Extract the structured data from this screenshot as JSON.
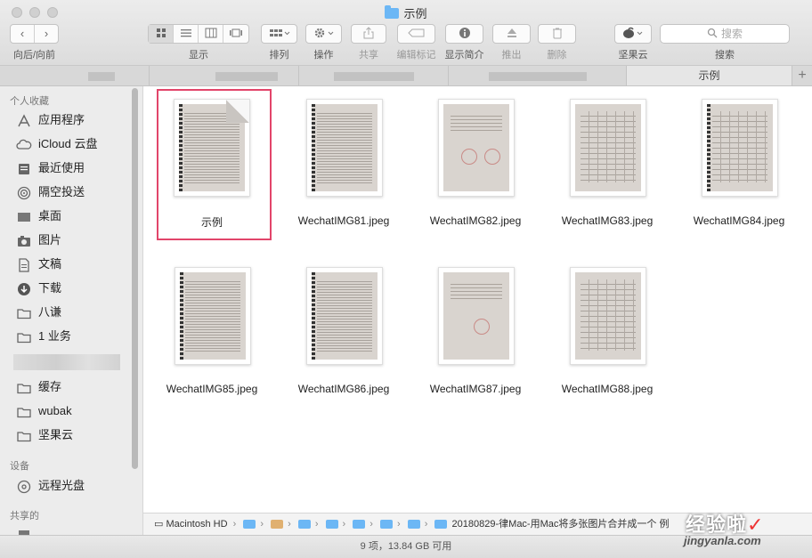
{
  "window": {
    "title": "示例"
  },
  "toolbar": {
    "nav_label": "向后/向前",
    "view_label": "显示",
    "sort_label": "排列",
    "action_label": "操作",
    "share_label": "共享",
    "tags_label": "编辑标记",
    "info_label": "显示简介",
    "eject_label": "推出",
    "delete_label": "删除",
    "nutstore_label": "坚果云",
    "search_label": "搜索",
    "search_placeholder": "搜索",
    "back_glyph": "‹",
    "forward_glyph": "›"
  },
  "tabs": {
    "active_label": "示例",
    "plus": "+"
  },
  "sidebar": {
    "favorites_header": "个人收藏",
    "favorites": [
      {
        "label": "应用程序",
        "icon": "applications-icon"
      },
      {
        "label": "iCloud 云盘",
        "icon": "icloud-icon"
      },
      {
        "label": "最近使用",
        "icon": "recents-icon"
      },
      {
        "label": "隔空投送",
        "icon": "airdrop-icon"
      },
      {
        "label": "桌面",
        "icon": "desktop-icon"
      },
      {
        "label": "图片",
        "icon": "pictures-icon"
      },
      {
        "label": "文稿",
        "icon": "documents-icon"
      },
      {
        "label": "下载",
        "icon": "downloads-icon"
      },
      {
        "label": "八谦",
        "icon": "folder-icon"
      },
      {
        "label": "1 业务",
        "icon": "folder-icon"
      },
      {
        "label": "缓存",
        "icon": "folder-icon"
      },
      {
        "label": "wubak",
        "icon": "folder-icon"
      },
      {
        "label": "坚果云",
        "icon": "folder-icon"
      }
    ],
    "devices_header": "设备",
    "devices": [
      {
        "label": "远程光盘",
        "icon": "remote-disc-icon"
      }
    ],
    "shared_header": "共享的"
  },
  "files": [
    {
      "name": "示例",
      "kind": "pdf",
      "selected": true
    },
    {
      "name": "WechatIMG81.jpeg",
      "kind": "text"
    },
    {
      "name": "WechatIMG82.jpeg",
      "kind": "letter"
    },
    {
      "name": "WechatIMG83.jpeg",
      "kind": "table"
    },
    {
      "name": "WechatIMG84.jpeg",
      "kind": "table"
    },
    {
      "name": "WechatIMG85.jpeg",
      "kind": "text"
    },
    {
      "name": "WechatIMG86.jpeg",
      "kind": "text"
    },
    {
      "name": "WechatIMG87.jpeg",
      "kind": "letter"
    },
    {
      "name": "WechatIMG88.jpeg",
      "kind": "table"
    }
  ],
  "pathbar": {
    "disk": "Macintosh HD",
    "last": "20180829-律Mac-用Mac将多张图片合并成一个",
    "tail": "例"
  },
  "status": {
    "text": "9 项，13.84 GB 可用"
  },
  "watermark": {
    "text": "经验啦",
    "check": "✓",
    "url": "jingyanla.com"
  },
  "colors": {
    "selection": "#e2456a",
    "folder": "#6cb7f5"
  }
}
